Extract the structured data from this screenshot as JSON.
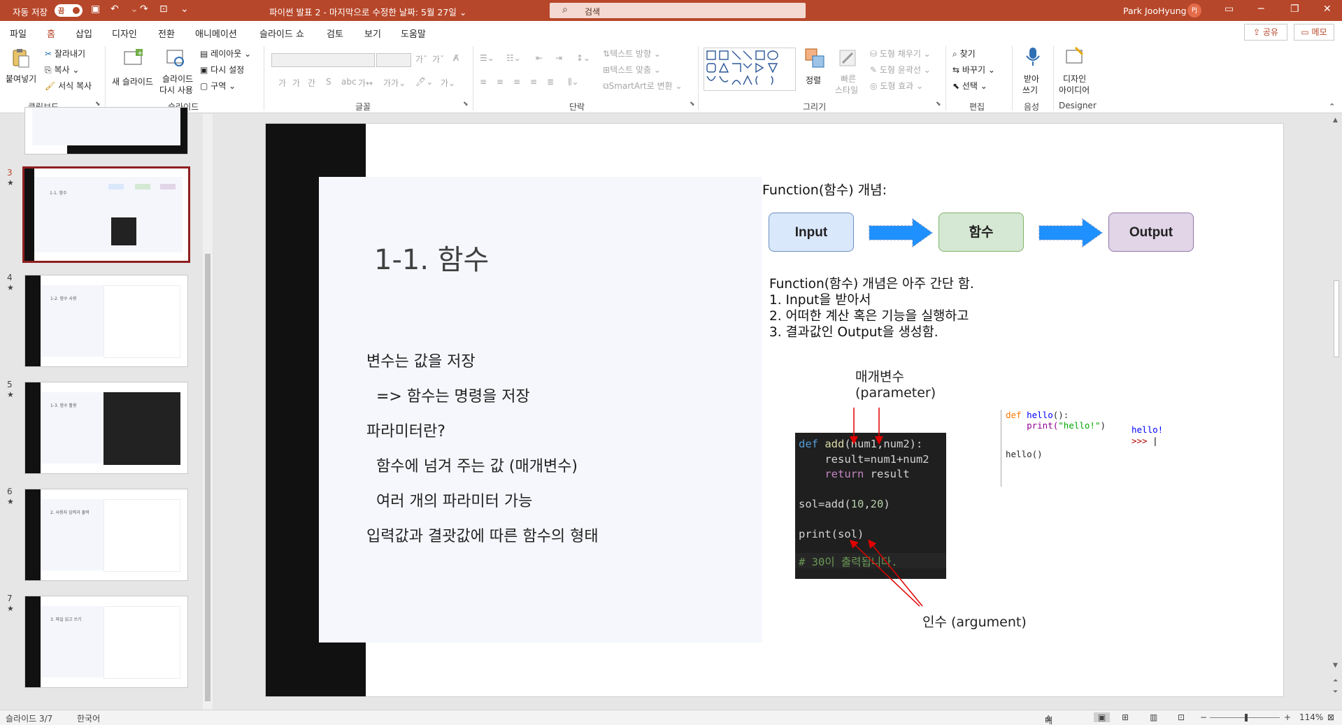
{
  "titlebar": {
    "autosave_label": "자동 저장",
    "autosave_state": "끔",
    "doc_title": "파이썬 발표 2 - 마지막으로 수정한 날짜: 5월 27일",
    "doc_title_caret": "⌄",
    "search_placeholder": "검색",
    "user_name": "Park JooHyung",
    "user_initials": "PJ"
  },
  "tabs": [
    "파일",
    "홈",
    "삽입",
    "디자인",
    "전환",
    "애니메이션",
    "슬라이드 쇼",
    "검토",
    "보기",
    "도움말"
  ],
  "active_tab": "홈",
  "share_label": "공유",
  "memo_label": "메모",
  "ribbon": {
    "clipboard": {
      "paste": "붙여넣기",
      "cut": "잘라내기",
      "copy": "복사",
      "format_painter": "서식 복사",
      "group": "클립보드"
    },
    "slides": {
      "new_slide": "새 슬라이드",
      "reuse_slide_1": "슬라이드",
      "reuse_slide_2": "다시 사용",
      "layout": "레이아웃",
      "reset": "다시 설정",
      "section": "구역",
      "group": "슬라이드"
    },
    "font": {
      "group": "글꼴"
    },
    "paragraph": {
      "text_direction": "텍스트 방향",
      "align_text": "텍스트 맞춤",
      "smartart": "SmartArt로 변환",
      "group": "단락"
    },
    "drawing": {
      "arrange": "정렬",
      "quick_styles_1": "빠른",
      "quick_styles_2": "스타일",
      "shape_fill": "도형 채우기",
      "shape_outline": "도형 윤곽선",
      "shape_effects": "도형 효과",
      "group": "그리기"
    },
    "editing": {
      "find": "찾기",
      "replace": "바꾸기",
      "select": "선택",
      "group": "편집"
    },
    "voice": {
      "dictate_1": "받아",
      "dictate_2": "쓰기",
      "group": "음성"
    },
    "designer": {
      "ideas_1": "디자인",
      "ideas_2": "아이디어",
      "group": "Designer"
    }
  },
  "thumbnails": [
    {
      "num": "3",
      "star": "★",
      "title": "1-1. 함수"
    },
    {
      "num": "4",
      "star": "★",
      "title": "1-2. 함수 사용"
    },
    {
      "num": "5",
      "star": "★",
      "title": "1-3. 함수 활용"
    },
    {
      "num": "6",
      "star": "★",
      "title": "2. 사용자 입력과 출력"
    },
    {
      "num": "7",
      "star": "★",
      "title": "3. 파일 읽고 쓰기"
    }
  ],
  "slide": {
    "title": "1-1. 함수",
    "body": [
      "변수는 값을 저장",
      "  => 함수는 명령을 저장",
      "파라미터란?",
      "  함수에 넘겨 주는 값 (매개변수)",
      "  여러 개의 파라미터 가능",
      "입력값과 결괏값에 따른 함수의 형태"
    ],
    "fn_heading": "Function(함수) 개념:",
    "flow": [
      "Input",
      "함수",
      "Output"
    ],
    "desc": [
      "Function(함수) 개념은 아주 간단 함.",
      "1. Input을 받아서",
      "2. 어떠한 계산 혹은 기능을 실행하고",
      "3. 결과값인 Output을 생성함."
    ],
    "param_label_1": "매개변수",
    "param_label_2": "(parameter)",
    "arg_label": "인수 (argument)",
    "code": {
      "l1_def": "def ",
      "l1_fn": "add",
      "l1_rest": "(num1,num2):",
      "l2": "    result=num1+num2",
      "l3_kw": "    return",
      "l3_rest": " result",
      "l5_a": "sol=add(",
      "l5_n1": "10",
      "l5_c": ",",
      "l5_n2": "20",
      "l5_e": ")",
      "l7": "print(sol)",
      "l9": "# 30이 출력됩니다."
    },
    "idle": {
      "l1_def": "def ",
      "l1_fn": "hello",
      "l1_rest": "():",
      "l2_a": "    print(",
      "l2_s": "\"hello!\"",
      "l2_e": ")",
      "l4": "hello()",
      "out": "hello!",
      "prompt": ">>> "
    }
  },
  "status": {
    "slide_info": "슬라이드 3/7",
    "language": "한국어",
    "notes": "메모",
    "zoom": "114%"
  }
}
